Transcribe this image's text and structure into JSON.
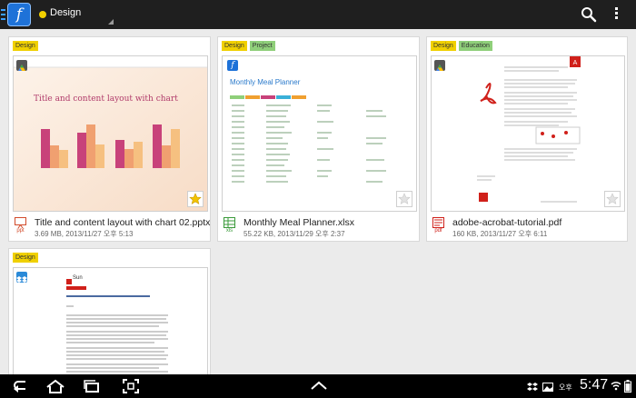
{
  "actionbar": {
    "category": "Design",
    "colors": {
      "category_dot": "#f2d000",
      "app_icon": "#1e72d8"
    },
    "icons": [
      "app-icon",
      "search-icon",
      "overflow-menu-icon"
    ]
  },
  "tags": {
    "design": "Design",
    "project": "Project",
    "education": "Education"
  },
  "files": [
    {
      "name": "Title and content layout with chart 02.pptx",
      "meta": "3.69 MB, 2013/11/27 오후 5:13",
      "ext": "ppt",
      "starred": true,
      "preview_title": "Title and content layout with chart"
    },
    {
      "name": "Monthly Meal Planner.xlsx",
      "meta": "55.22 KB, 2013/11/29 오후 2:37",
      "ext": "xls",
      "starred": false,
      "preview_title": "Monthly Meal Planner"
    },
    {
      "name": "adobe-acrobat-tutorial.pdf",
      "meta": "160 KB, 2013/11/27 오후 6:11",
      "ext": "pdf",
      "starred": false
    },
    {
      "preview_brand": "Sun"
    }
  ],
  "statusbar": {
    "ampm": "오후",
    "time": "5:47"
  }
}
